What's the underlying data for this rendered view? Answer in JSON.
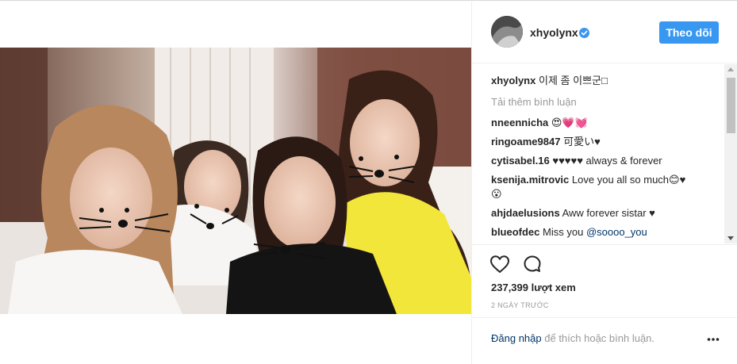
{
  "post": {
    "username": "xhyolynx",
    "follow_label": "Theo dõi",
    "caption": {
      "username": "xhyolynx",
      "text": "이제 좀 이쁘군□"
    },
    "load_more_label": "Tải thêm bình luận",
    "comments": [
      {
        "username": "nneennicha",
        "text": "😍💗💓",
        "mention": ""
      },
      {
        "username": "ringoame9847",
        "text": "可愛い♥",
        "mention": ""
      },
      {
        "username": "cytisabel.16",
        "text": "♥♥♥♥♥ always & forever",
        "mention": ""
      },
      {
        "username": "ksenija.mitrovic",
        "text": "Love you all so much😊♥",
        "text2": "😮",
        "mention": ""
      },
      {
        "username": "ahjdaelusions",
        "text": "Aww forever sistar ♥",
        "mention": ""
      },
      {
        "username": "blueofdec",
        "text": "Miss you",
        "mention": "@soooo_you"
      }
    ],
    "views_label": "237,399 lượt xem",
    "time_label": "2 NGÀY TRƯỚC",
    "login_link": "Đăng nhập",
    "login_rest": "để thích hoặc bình luận."
  },
  "icons": {
    "verified": "verified-badge-icon",
    "like": "heart-icon",
    "comment": "comment-bubble-icon",
    "more": "more-options-icon"
  },
  "colors": {
    "accent": "#3897f0",
    "link": "#003569",
    "muted": "#999999",
    "text": "#262626"
  }
}
